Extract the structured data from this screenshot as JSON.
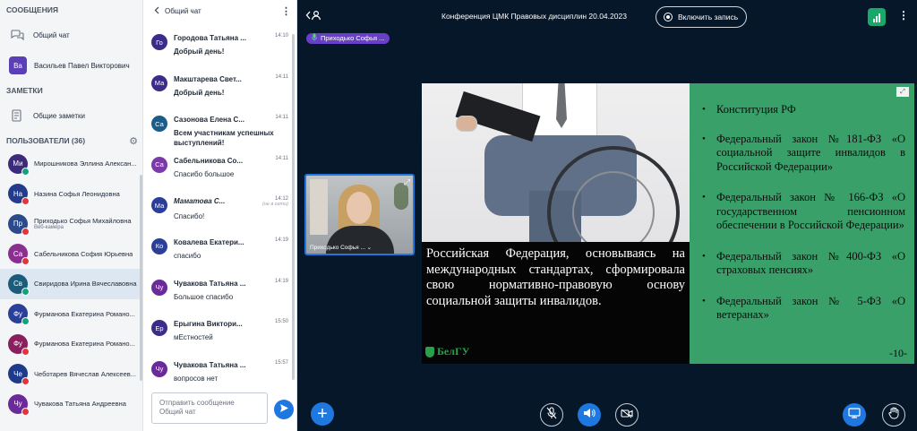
{
  "sidebar": {
    "messages_title": "СООБЩЕНИЯ",
    "public_chat": "Общий чат",
    "dm_user": {
      "initials": "Ва",
      "name": "Васильев Павел Викторович"
    },
    "notes_title": "ЗАМЕТКИ",
    "shared_notes": "Общие заметки",
    "users_title": "ПОЛЬЗОВАТЕЛИ (36)",
    "users": [
      {
        "initials": "Ми",
        "name": "Мирошникова Эллина Алексан...",
        "color": "#3b2b7a",
        "status": "green"
      },
      {
        "initials": "На",
        "name": "Назина Софья Леонидовна",
        "color": "#243b8c",
        "status": "red"
      },
      {
        "initials": "Пр",
        "name": "Приходько Софья Михайловна",
        "sub": "Веб-камера",
        "color": "#2b4a8b",
        "status": "red"
      },
      {
        "initials": "Са",
        "name": "Сабельникова София Юрьевна",
        "color": "#8a2f8f",
        "status": "red"
      },
      {
        "initials": "Св",
        "name": "Свиридова Ирина Вячеславовна",
        "color": "#1b5c7a",
        "status": "green"
      },
      {
        "initials": "Фу",
        "name": "Фурманова Екатерина Романо...",
        "color": "#2a3f9a",
        "status": "green"
      },
      {
        "initials": "Фу",
        "name": "Фурманова Екатерина Романо...",
        "color": "#8a1f5e",
        "status": "red"
      },
      {
        "initials": "Че",
        "name": "Чеботарев Вячеслав Алексеев...",
        "color": "#1e3a8a",
        "status": "red"
      },
      {
        "initials": "Чу",
        "name": "Чувакова Татьяна Андреевна",
        "color": "#6b2a9a",
        "status": "red"
      }
    ]
  },
  "chat": {
    "title": "Общий чат",
    "messages": [
      {
        "initials": "Го",
        "name": "Городова Татьяна ...",
        "time": "14:10",
        "text": "Добрый день!",
        "bold": true,
        "color": "#3b2b8a"
      },
      {
        "initials": "Ма",
        "name": "Макштарева Свет...",
        "time": "14:11",
        "text": "Добрый день!",
        "bold": true,
        "color": "#3b2b8a"
      },
      {
        "initials": "Са",
        "name": "Сазонова Елена С...",
        "time": "14:11",
        "text": "Всем участникам успешных выступлений!",
        "bold": true,
        "color": "#1b5c8a"
      },
      {
        "initials": "Са",
        "name": "Сабельникова Со...",
        "time": "14:11",
        "text": "Спасибо большое",
        "bold": false,
        "color": "#7b3aa8"
      },
      {
        "initials": "Ма",
        "name": "Маматова С...",
        "time": "14:12",
        "offline": "(не в сети)",
        "text": "Спасибо!",
        "bold": false,
        "italic": true,
        "color": "#2b3f9a"
      },
      {
        "initials": "Ко",
        "name": "Ковалева Екатери...",
        "time": "14:19",
        "text": "спасибо",
        "bold": false,
        "color": "#2b3f9a"
      },
      {
        "initials": "Чу",
        "name": "Чувакова Татьяна ...",
        "time": "14:19",
        "text": "Большое спасибо",
        "bold": false,
        "color": "#6b2a9a"
      },
      {
        "initials": "Ер",
        "name": "Ерыгина Виктори...",
        "time": "15:50",
        "text": "мЕстностей",
        "bold": false,
        "color": "#3b2b8a"
      },
      {
        "initials": "Чу",
        "name": "Чувакова Татьяна ...",
        "time": "15:57",
        "text": "вопросов нет",
        "bold": false,
        "color": "#6b2a9a"
      }
    ],
    "composer_placeholder": "Отправить сообщение Общий чат"
  },
  "stage": {
    "title": "Конференция ЦМК Правовых дисциплин 20.04.2023",
    "record_label": "Включить запись",
    "talker": "Приходько Софья ...",
    "camera_label": "Приходько Софья ...",
    "slide": {
      "main_text": "Российская Федерация, основываясь на международных стандартах, сформировала свою нормативно-правовую основу социальной защиты инвалидов.",
      "logo_text": "БелГУ",
      "laws": [
        "Конституция РФ",
        "Федеральный закон №181-ФЗ «О социальной защите инвалидов в Российской Федерации»",
        "Федеральный закон № 166-ФЗ «О государственном пенсионном обеспечении в Российской Федерации»",
        "Федеральный закон №400-ФЗ «О страховых пенсиях»",
        "Федеральный закон № 5-ФЗ «О ветеранах»"
      ],
      "page_number": "-10-"
    }
  },
  "colors": {
    "accent": "#1f78e0",
    "stage_bg": "#06172a",
    "slide_green": "#3aa06a",
    "talker_purple": "#6a3fc7"
  }
}
